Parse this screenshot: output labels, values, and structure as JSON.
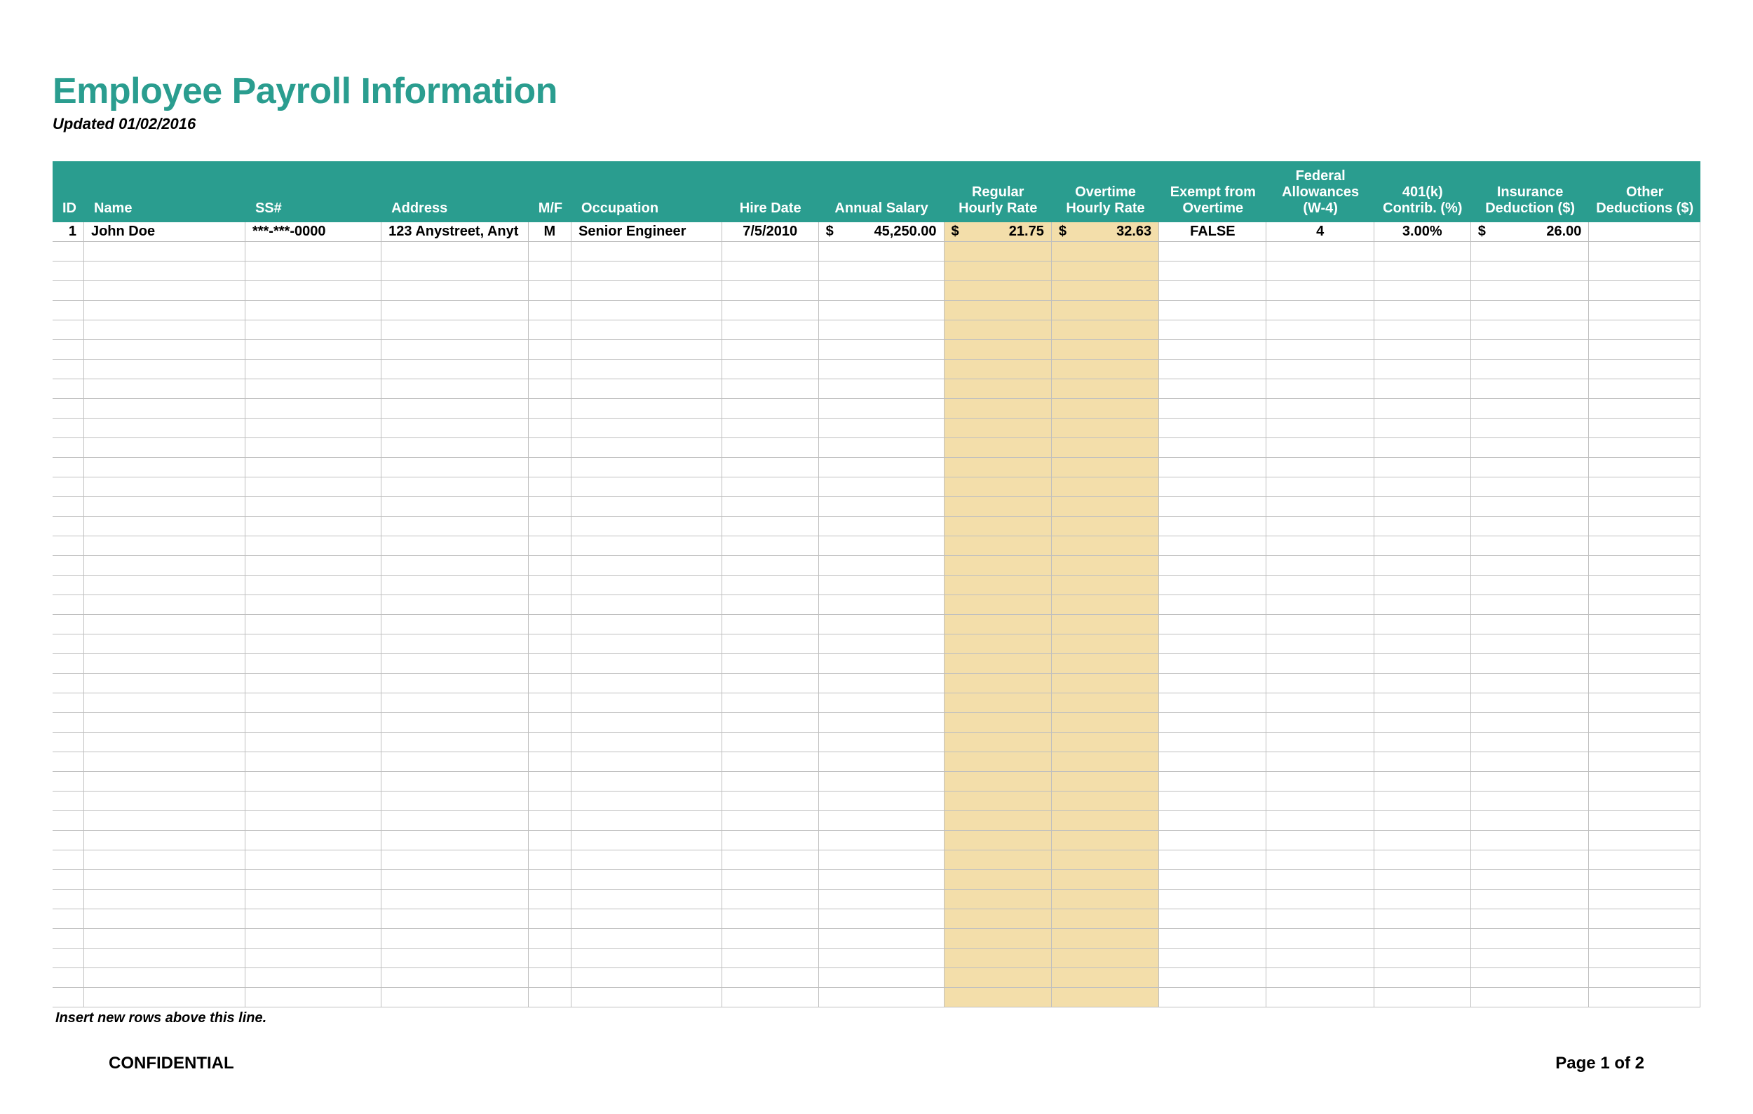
{
  "title": "Employee Payroll Information",
  "updated": "Updated 01/02/2016",
  "headers": {
    "id": "ID",
    "name": "Name",
    "ss": "SS#",
    "address": "Address",
    "mf": "M/F",
    "occupation": "Occupation",
    "hire_date": "Hire Date",
    "annual_salary": "Annual Salary",
    "regular_rate": "Regular Hourly Rate",
    "overtime_rate": "Overtime Hourly Rate",
    "exempt": "Exempt from Overtime",
    "fed_allow": "Federal Allowances (W-4)",
    "k401": "401(k) Contrib. (%)",
    "insurance": "Insurance Deduction ($)",
    "other": "Other Deductions ($)"
  },
  "rows": [
    {
      "id": "1",
      "name": "John Doe",
      "ss": "***-***-0000",
      "address": "123 Anystreet, Anyt",
      "mf": "M",
      "occupation": "Senior Engineer",
      "hire_date": "7/5/2010",
      "salary_sym": "$",
      "salary": "45,250.00",
      "reg_sym": "$",
      "regular": "21.75",
      "ot_sym": "$",
      "overtime": "32.63",
      "exempt": "FALSE",
      "fed_allow": "4",
      "k401": "3.00%",
      "ins_sym": "$",
      "insurance": "26.00",
      "other": ""
    }
  ],
  "empty_row_count": 39,
  "insert_note": "Insert new rows above this line.",
  "footer": {
    "left": "CONFIDENTIAL",
    "right": "Page 1 of 2"
  },
  "colors": {
    "header_bg": "#2a9d8f",
    "highlight_bg": "#f3deaa",
    "grid": "#bfbfbf"
  }
}
